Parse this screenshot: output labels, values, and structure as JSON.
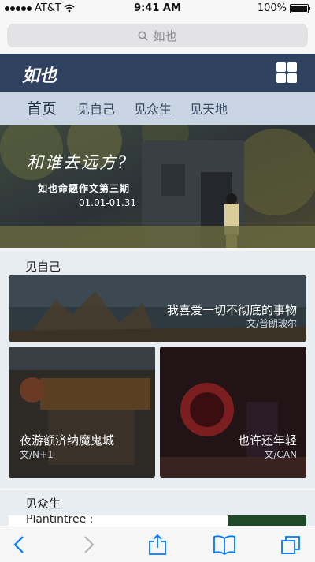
{
  "status": {
    "carrier": "AT&T",
    "time": "9:41 AM",
    "battery": "100%"
  },
  "browser": {
    "search_text": "如也"
  },
  "app": {
    "logo": "如也"
  },
  "tabs": [
    {
      "label": "首页"
    },
    {
      "label": "见自己"
    },
    {
      "label": "见众生"
    },
    {
      "label": "见天地"
    }
  ],
  "hero": {
    "title": "和谁去远方?",
    "subtitle": "如也命题作文第三期",
    "dates": "01.01-01.31"
  },
  "section1": {
    "title": "见自己",
    "cards": [
      {
        "title": "我喜爱一切不彻底的事物",
        "author": "文/普朗玻尔"
      },
      {
        "title": "夜游额济纳魔鬼城",
        "author": "文/N+1"
      },
      {
        "title": "也许还年轻",
        "author": "文/CAN"
      }
    ]
  },
  "section2": {
    "title": "见众生",
    "preview_text": "Plantintree :"
  },
  "colors": {
    "appbar": "#2f4260",
    "tabs_bg": "#c9d5e2",
    "accent": "#007aff"
  }
}
